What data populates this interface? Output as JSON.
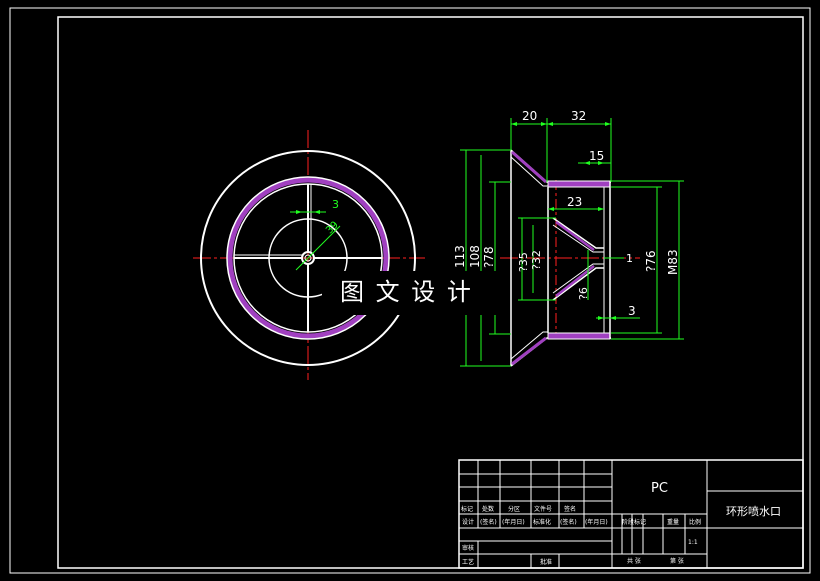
{
  "watermark": "图 文 设 计",
  "dimensions": {
    "d20": "20",
    "d32": "32",
    "d15": "15",
    "d23": "23",
    "d3_right": "3",
    "d1": "1",
    "d113": "113",
    "d108": "108",
    "d78": "?78",
    "d35": "?35",
    "d32v": "?32",
    "d6": "?6",
    "d76": "?76",
    "m83": "M83",
    "d3_left": "3",
    "d39": "39"
  },
  "title_block": {
    "material": "PC",
    "part_name": "环形喷水口",
    "scale": "1:1",
    "row_labels": {
      "mark": "标记",
      "count": "处数",
      "zone": "分区",
      "doc_no": "文件号",
      "sign": "签名",
      "design": "设计",
      "sign_paren": "(签名)",
      "date_paren": "(年月日)",
      "standardize": "标准化",
      "sign_paren2": "(签名)",
      "date_paren2": "(年月日)",
      "review": "审核",
      "process": "工艺",
      "approve": "批准"
    },
    "stage_mark": "阶段标记",
    "weight": "重量",
    "ratio": "比例",
    "sheets_total": "共    张",
    "sheet_no": "第    张"
  }
}
